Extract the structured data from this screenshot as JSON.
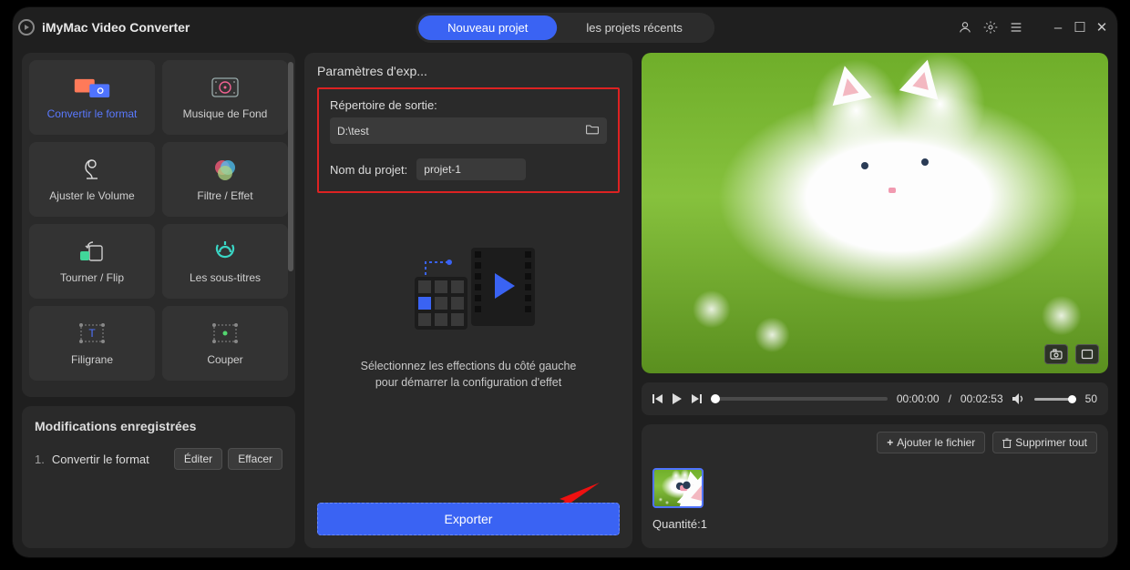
{
  "app_title": "iMyMac Video Converter",
  "tabs": {
    "new_project": "Nouveau projet",
    "recent_projects": "les projets récents"
  },
  "titlebar_icons": {
    "account": "account-icon",
    "settings": "gear-icon",
    "menu": "menu-icon"
  },
  "window_controls": {
    "minimize": "–",
    "maximize": "☐",
    "close": "✕"
  },
  "tools": [
    {
      "label": "Convertir le format",
      "icon": "convert-icon",
      "active": true
    },
    {
      "label": "Musique de Fond",
      "icon": "music-icon",
      "active": false
    },
    {
      "label": "Ajuster le Volume",
      "icon": "volume-icon",
      "active": false
    },
    {
      "label": "Filtre / Effet",
      "icon": "filter-icon",
      "active": false
    },
    {
      "label": "Tourner / Flip",
      "icon": "rotate-icon",
      "active": false
    },
    {
      "label": "Les sous-titres",
      "icon": "subtitles-icon",
      "active": false
    },
    {
      "label": "Filigrane",
      "icon": "watermark-icon",
      "active": false
    },
    {
      "label": "Couper",
      "icon": "cut-icon",
      "active": false
    }
  ],
  "mods": {
    "title": "Modifications enregistrées",
    "items": [
      {
        "num": "1.",
        "label": "Convertir le format",
        "edit": "Éditer",
        "clear": "Effacer"
      }
    ]
  },
  "center": {
    "title": "Paramètres d'exp...",
    "output_dir_label": "Répertoire de sortie:",
    "output_dir_value": "D:\\test",
    "project_name_label": "Nom du projet:",
    "project_name_value": "projet-1",
    "hint_line1": "Sélectionnez les effections du côté gauche",
    "hint_line2": "pour démarrer la configuration d'effet",
    "export_label": "Exporter"
  },
  "player": {
    "current_time": "00:00:00",
    "duration": "00:02:53",
    "volume": "50"
  },
  "file_panel": {
    "add_file": "Ajouter le fichier",
    "delete_all": "Supprimer tout",
    "quantity_label": "Quantité:",
    "quantity_value": "1"
  }
}
